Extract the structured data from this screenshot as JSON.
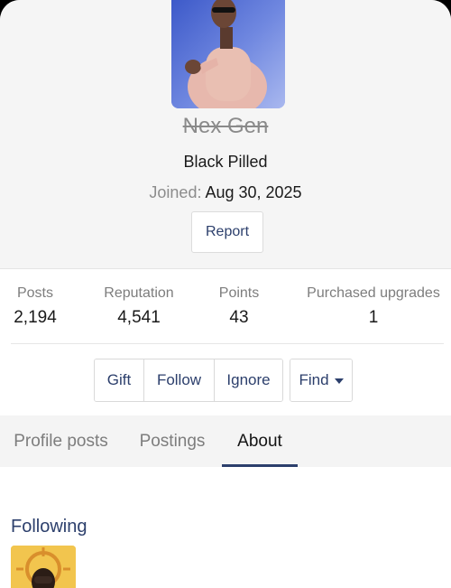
{
  "profile": {
    "username": "Nex Gen",
    "user_title": "Black Pilled",
    "joined_label": "Joined:",
    "joined_value": "Aug 30, 2025",
    "report_label": "Report"
  },
  "stats": [
    {
      "label": "Posts",
      "value": "2,194"
    },
    {
      "label": "Reputation",
      "value": "4,541"
    },
    {
      "label": "Points",
      "value": "43"
    },
    {
      "label": "Purchased upgrades",
      "value": "1"
    }
  ],
  "actions": {
    "gift": "Gift",
    "follow": "Follow",
    "ignore": "Ignore",
    "find": "Find"
  },
  "tabs": [
    {
      "label": "Profile posts",
      "active": false
    },
    {
      "label": "Postings",
      "active": false
    },
    {
      "label": "About",
      "active": true
    }
  ],
  "about": {
    "following_title": "Following"
  },
  "colors": {
    "accent": "#2c3f6c",
    "header_bg": "#f5f5f5",
    "muted_text": "#7d7d7d"
  },
  "icons": [
    "caret-down-icon"
  ]
}
